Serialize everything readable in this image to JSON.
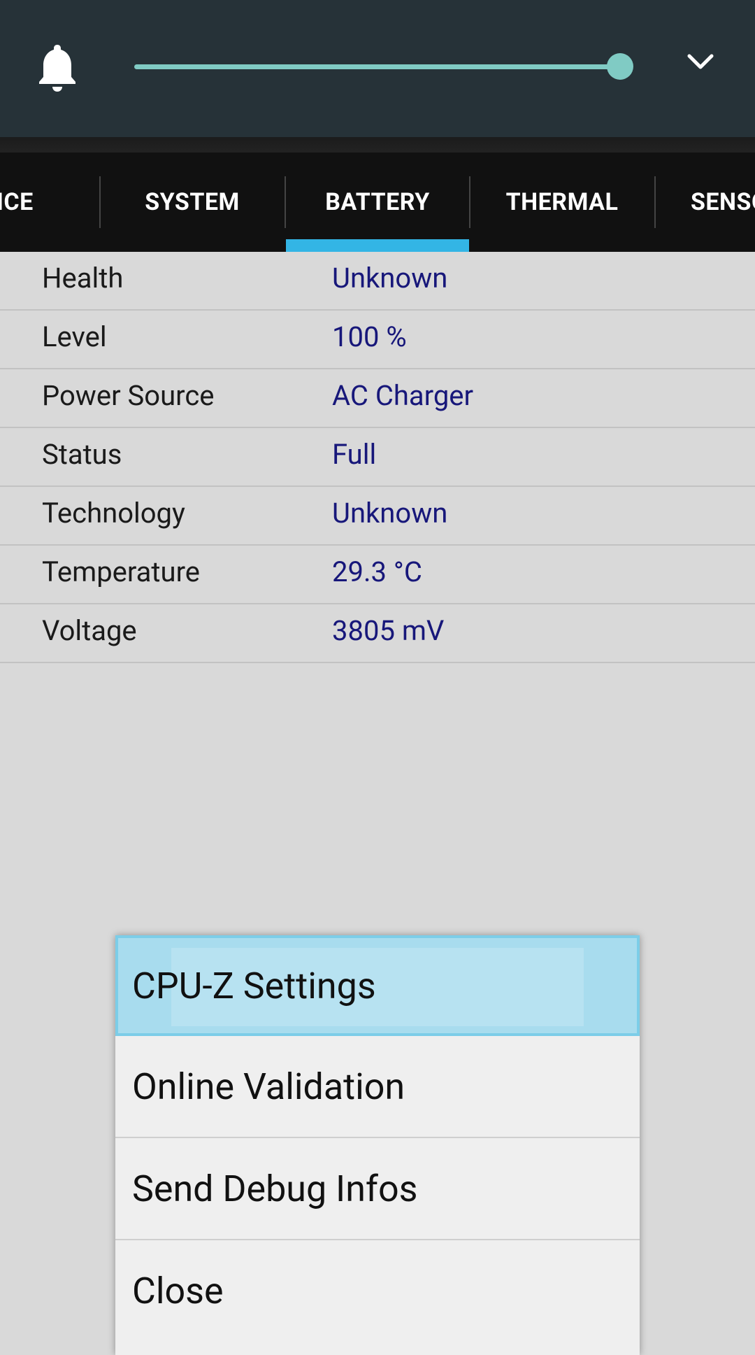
{
  "tabs": [
    "VICE",
    "SYSTEM",
    "BATTERY",
    "THERMAL",
    "SENSORS"
  ],
  "active_tab": "BATTERY",
  "volume_level": 1.0,
  "battery": [
    {
      "label": "Health",
      "value": "Unknown"
    },
    {
      "label": "Level",
      "value": "100 %"
    },
    {
      "label": "Power Source",
      "value": "AC Charger"
    },
    {
      "label": "Status",
      "value": "Full"
    },
    {
      "label": "Technology",
      "value": "Unknown"
    },
    {
      "label": "Temperature",
      "value": "29.3 °C"
    },
    {
      "label": "Voltage",
      "value": "3805 mV"
    }
  ],
  "menu": {
    "items": [
      "CPU-Z Settings",
      "Online Validation",
      "Send Debug Infos",
      "Close"
    ],
    "selected_index": 0
  },
  "icons": {
    "bell": "bell-icon",
    "chevron": "chevron-down-icon"
  },
  "colors": {
    "panel_bg": "#263238",
    "slider": "#80cbc4",
    "tab_indicator": "#33b5e5",
    "value_text": "#17177a",
    "menu_selected": "#a8dcee"
  }
}
